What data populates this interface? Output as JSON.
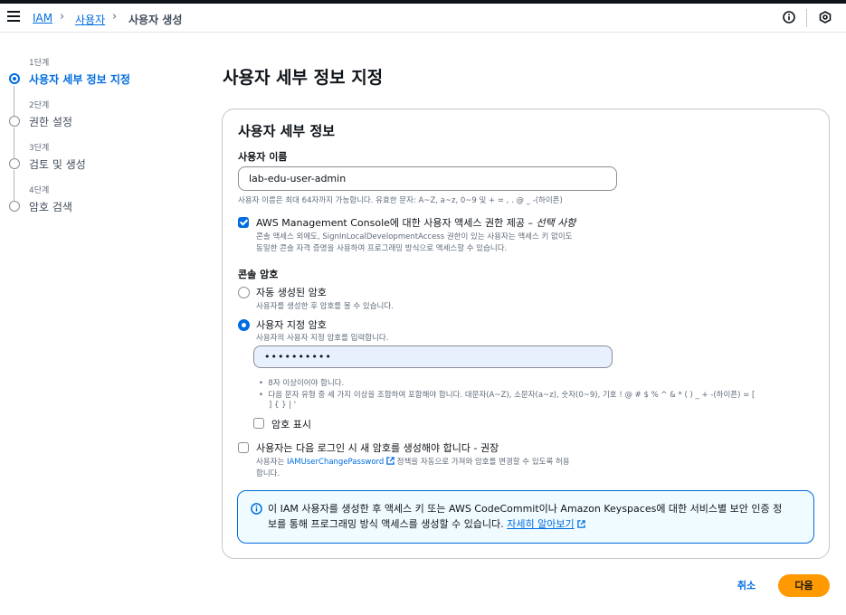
{
  "header": {
    "breadcrumb": [
      "IAM",
      "사용자",
      "사용자 생성"
    ]
  },
  "steps": [
    {
      "num": "1단계",
      "label": "사용자 세부 정보 지정",
      "active": true
    },
    {
      "num": "2단계",
      "label": "권한 설정",
      "active": false
    },
    {
      "num": "3단계",
      "label": "검토 및 생성",
      "active": false
    },
    {
      "num": "4단계",
      "label": "암호 검색",
      "active": false
    }
  ],
  "page_title": "사용자 세부 정보 지정",
  "card": {
    "title": "사용자 세부 정보",
    "username_label": "사용자 이름",
    "username_value": "lab-edu-user-admin",
    "username_hint": "사용자 이름은 최대 64자까지 가능합니다. 유효한 문자: A~Z, a~z, 0~9 및 + = , . @ _ -(하이픈)",
    "console_access_label": "AWS Management Console에 대한 사용자 액세스 권한 제공 –",
    "console_access_optional": "선택 사항",
    "console_access_checked": true,
    "console_access_desc_1": "콘솔 액세스 외에도, SignInLocalDevelopmentAccess 권한이 있는 사용자는 액세스 키 없이도",
    "console_access_desc_2": "동일한 콘솔 자격 증명을 사용하여 프로그래밍 방식으로 액세스할 수 있습니다.",
    "password_section_label": "콘솔 암호",
    "auto_pw_label": "자동 생성된 암호",
    "auto_pw_desc": "사용자를 생성한 후 암호를 볼 수 있습니다.",
    "custom_pw_label": "사용자 지정 암호",
    "custom_pw_desc": "사용자의 사용자 지정 암호를 입력합니다.",
    "custom_pw_selected": true,
    "password_value": "••••••••••",
    "pw_rule_1": "8자 이상이어야 합니다.",
    "pw_rule_2a": "다음 문자 유형 중 세 가지 이상을 조합하여 포함해야 합니다. 대문자(A~Z), 소문자(a~z), 숫자(0~9), 기호 ! @ # $ % ^ & * ( ) _ + -(하이픈) = [",
    "pw_rule_2b": "] { } | '",
    "show_pw_label": "암호 표시",
    "show_pw_checked": false,
    "reset_pw_label": "사용자는 다음 로그인 시 새 암호를 생성해야 합니다 - 권장",
    "reset_pw_checked": false,
    "reset_pw_desc_prefix": "사용자는",
    "reset_pw_link": "IAMUserChangePassword",
    "reset_pw_desc_suffix": "정책을 자동으로 가져와 암호를 변경할 수 있도록 허용",
    "reset_pw_desc_2": "합니다.",
    "info_text_1": "이 IAM 사용자를 생성한 후 액세스 키 또는 AWS CodeCommit이나 Amazon Keyspaces에 대한 서비스별 보안 인증 정",
    "info_text_2": "보를 통해 프로그래밍 방식 액세스를 생성할 수 있습니다.",
    "info_link": "자세히 알아보기"
  },
  "footer": {
    "cancel_label": "취소",
    "next_label": "다음"
  },
  "colors": {
    "link": "#006ce0",
    "primary_button": "#ff9900",
    "info_border": "#006ce0"
  }
}
